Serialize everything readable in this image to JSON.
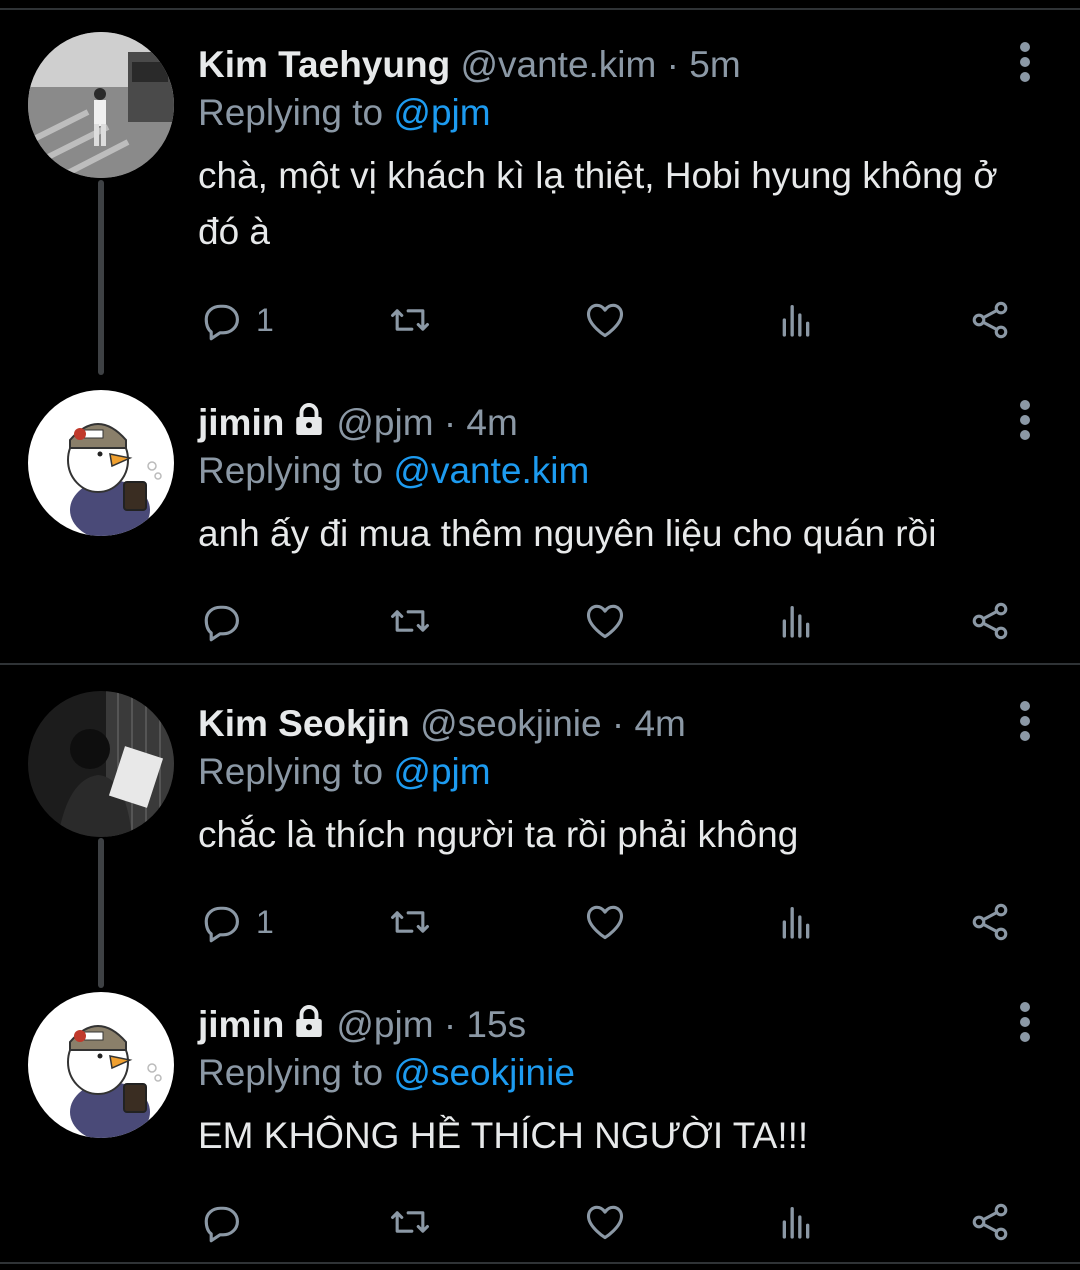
{
  "tweets": [
    {
      "name": "Kim Taehyung",
      "handle": "@vante.kim",
      "time": "5m",
      "locked": false,
      "replying_prefix": "Replying to",
      "replying_to": "@pjm",
      "text": "chà, một vị khách kì lạ thiệt, Hobi hyung không ở đó à",
      "reply_count": "1",
      "avatar": "street-photo"
    },
    {
      "name": "jimin",
      "handle": "@pjm",
      "time": "4m",
      "locked": true,
      "replying_prefix": "Replying to",
      "replying_to": "@vante.kim",
      "text": "anh ấy đi mua thêm nguyên liệu cho quán rồi",
      "reply_count": "",
      "avatar": "duck-cartoon"
    },
    {
      "name": "Kim Seokjin",
      "handle": "@seokjinie",
      "time": "4m",
      "locked": false,
      "replying_prefix": "Replying to",
      "replying_to": "@pjm",
      "text": "chắc là thích người ta rồi phải không",
      "reply_count": "1",
      "avatar": "studio-photo"
    },
    {
      "name": "jimin",
      "handle": "@pjm",
      "time": "15s",
      "locked": true,
      "replying_prefix": "Replying to",
      "replying_to": "@seokjinie",
      "text": "EM KHÔNG HỀ THÍCH NGƯỜI TA!!!",
      "reply_count": "",
      "avatar": "duck-cartoon"
    }
  ],
  "separator": "·",
  "icons": {
    "reply": "reply-icon",
    "retweet": "retweet-icon",
    "like": "heart-icon",
    "views": "views-icon",
    "share": "share-icon",
    "more": "more-icon",
    "lock": "lock-icon"
  },
  "colors": {
    "background": "#000000",
    "text": "#e7e9ea",
    "secondary": "#8b98a5",
    "link": "#1d9bf0",
    "divider": "#2f3336"
  }
}
